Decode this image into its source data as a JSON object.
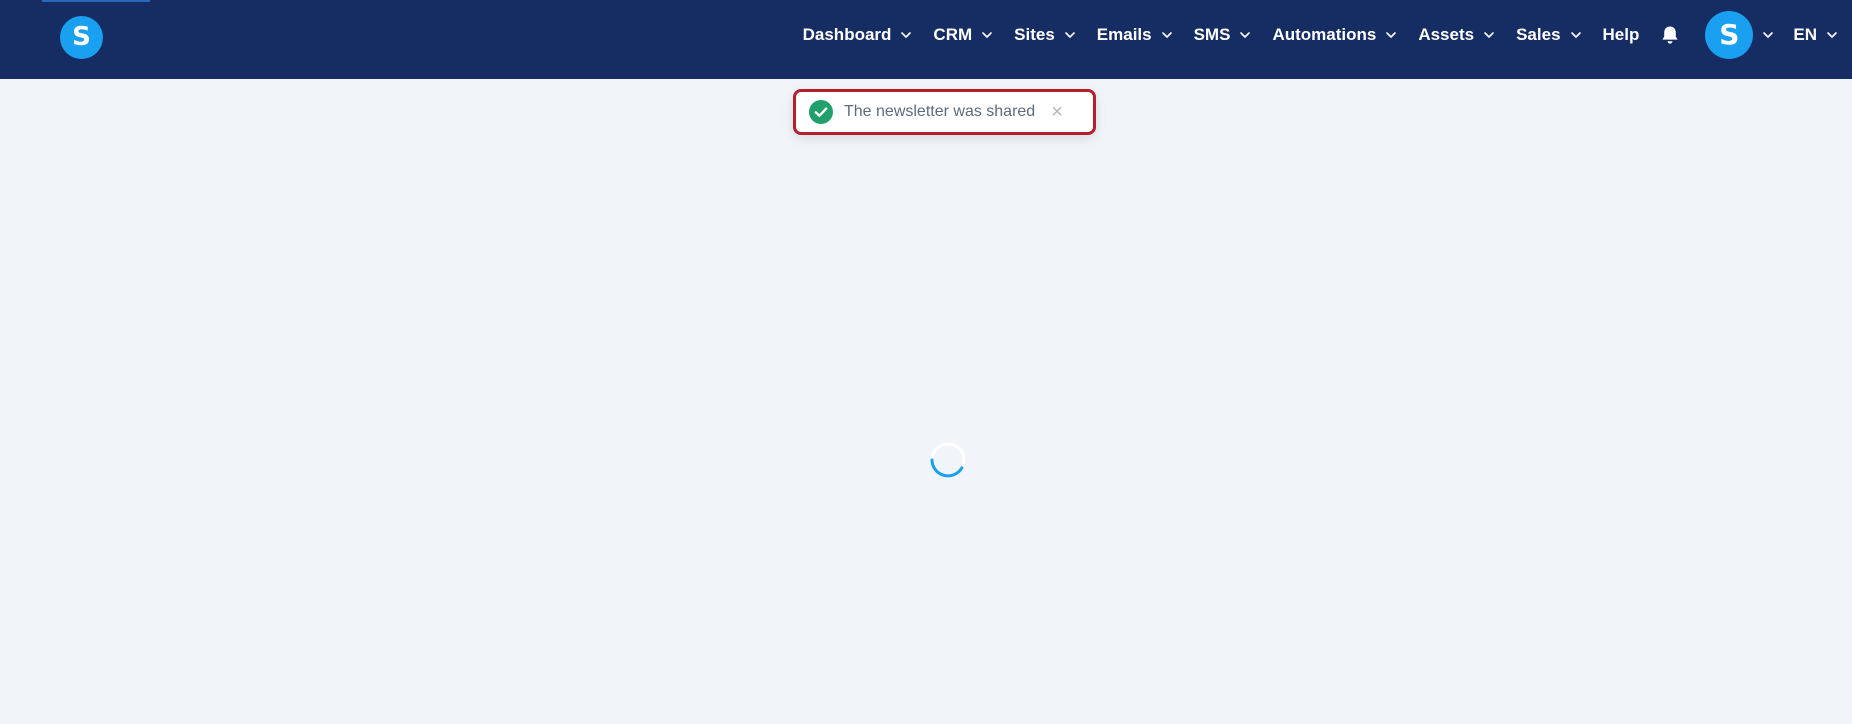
{
  "header": {
    "logo_letter": "S",
    "nav_items": [
      {
        "label": "Dashboard",
        "has_dropdown": true
      },
      {
        "label": "CRM",
        "has_dropdown": true
      },
      {
        "label": "Sites",
        "has_dropdown": true
      },
      {
        "label": "Emails",
        "has_dropdown": true
      },
      {
        "label": "SMS",
        "has_dropdown": true
      },
      {
        "label": "Automations",
        "has_dropdown": true
      },
      {
        "label": "Assets",
        "has_dropdown": true
      },
      {
        "label": "Sales",
        "has_dropdown": true
      },
      {
        "label": "Help",
        "has_dropdown": false
      }
    ],
    "notification_icon": "bell-icon",
    "avatar_letter": "S",
    "language": "EN",
    "colors": {
      "background": "#162d63",
      "accent": "#19a0f0"
    }
  },
  "toast": {
    "message": "The newsletter was shared",
    "icon": "check-circle-icon",
    "close_symbol": "×",
    "colors": {
      "success": "#22a06b",
      "border": "#b1202b"
    }
  },
  "main": {
    "loading_indicator": "spinner-icon"
  }
}
